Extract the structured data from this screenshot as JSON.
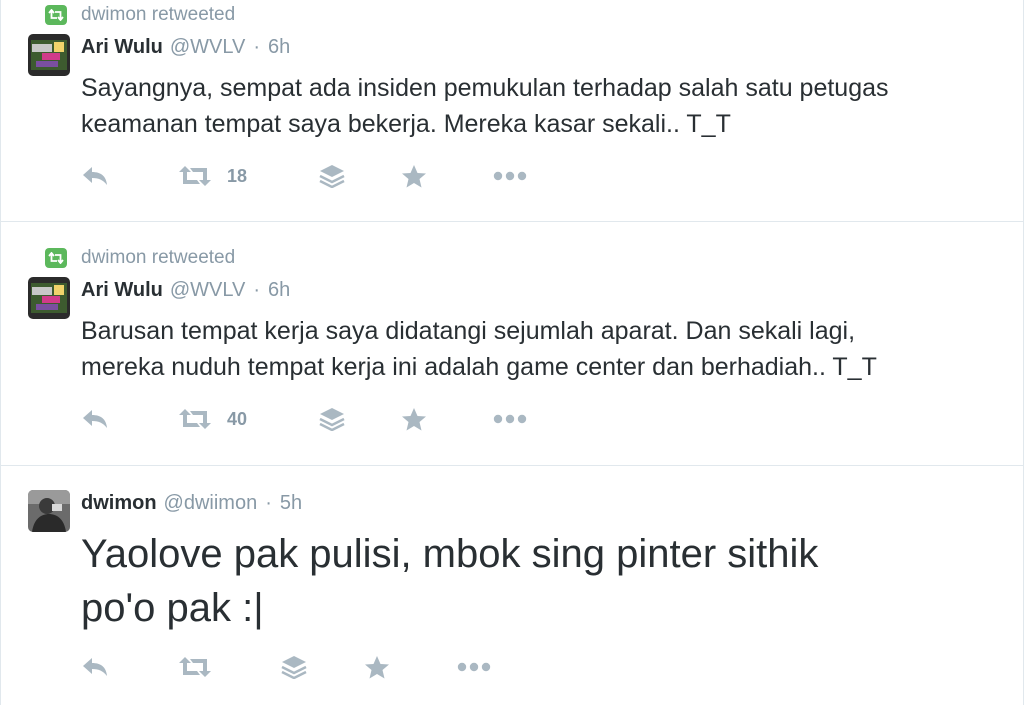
{
  "colors": {
    "text": "#292f33",
    "muted": "#8899a6",
    "icon": "#aab8c2",
    "retweet_badge": "#5cb85c",
    "divider": "#e1e8ed"
  },
  "tweets": [
    {
      "retweeted_by": "dwimon retweeted",
      "name": "Ari Wulu",
      "handle": "@WVLV",
      "separator": "·",
      "time": "6h",
      "text_lines": [
        "Sayangnya, sempat ada insiden pemukulan terhadap salah satu petugas",
        "keamanan tempat saya bekerja. Mereka kasar sekali.. T_T"
      ],
      "retweet_count": "18",
      "actions": [
        "reply-icon",
        "retweet-icon",
        "stack-icon",
        "star-icon",
        "more-icon"
      ]
    },
    {
      "retweeted_by": "dwimon retweeted",
      "name": "Ari Wulu",
      "handle": "@WVLV",
      "separator": "·",
      "time": "6h",
      "text_lines": [
        "Barusan tempat kerja saya didatangi sejumlah aparat. Dan sekali lagi,",
        "mereka nuduh tempat kerja ini adalah game center dan berhadiah.. T_T"
      ],
      "retweet_count": "40",
      "actions": [
        "reply-icon",
        "retweet-icon",
        "stack-icon",
        "star-icon",
        "more-icon"
      ]
    },
    {
      "name": "dwimon",
      "handle": "@dwiimon",
      "separator": "·",
      "time": "5h",
      "text_lines": [
        "Yaolove pak pulisi, mbok sing pinter sithik",
        "po'o pak :|"
      ],
      "actions": [
        "reply-icon",
        "retweet-icon",
        "stack-icon",
        "star-icon",
        "more-icon"
      ]
    }
  ]
}
